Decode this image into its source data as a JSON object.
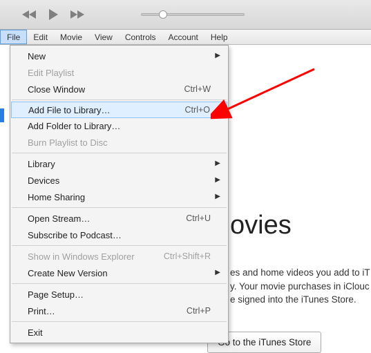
{
  "menubar": {
    "file": "File",
    "edit": "Edit",
    "movie": "Movie",
    "view": "View",
    "controls": "Controls",
    "account": "Account",
    "help": "Help"
  },
  "dropdown": {
    "new": "New",
    "edit_playlist": "Edit Playlist",
    "close_window": "Close Window",
    "close_window_sc": "Ctrl+W",
    "add_file": "Add File to Library…",
    "add_file_sc": "Ctrl+O",
    "add_folder": "Add Folder to Library…",
    "burn_playlist": "Burn Playlist to Disc",
    "library": "Library",
    "devices": "Devices",
    "home_sharing": "Home Sharing",
    "open_stream": "Open Stream…",
    "open_stream_sc": "Ctrl+U",
    "subscribe_podcast": "Subscribe to Podcast…",
    "show_explorer": "Show in Windows Explorer",
    "show_explorer_sc": "Ctrl+Shift+R",
    "create_new_version": "Create New Version",
    "page_setup": "Page Setup…",
    "print": "Print…",
    "print_sc": "Ctrl+P",
    "exit": "Exit"
  },
  "main": {
    "title": "ovies",
    "desc_l1": "es and home videos you add to iT",
    "desc_l2": "y. Your movie purchases in iClouc",
    "desc_l3": "e signed into the iTunes Store.",
    "store_button": "Go to the iTunes Store"
  }
}
